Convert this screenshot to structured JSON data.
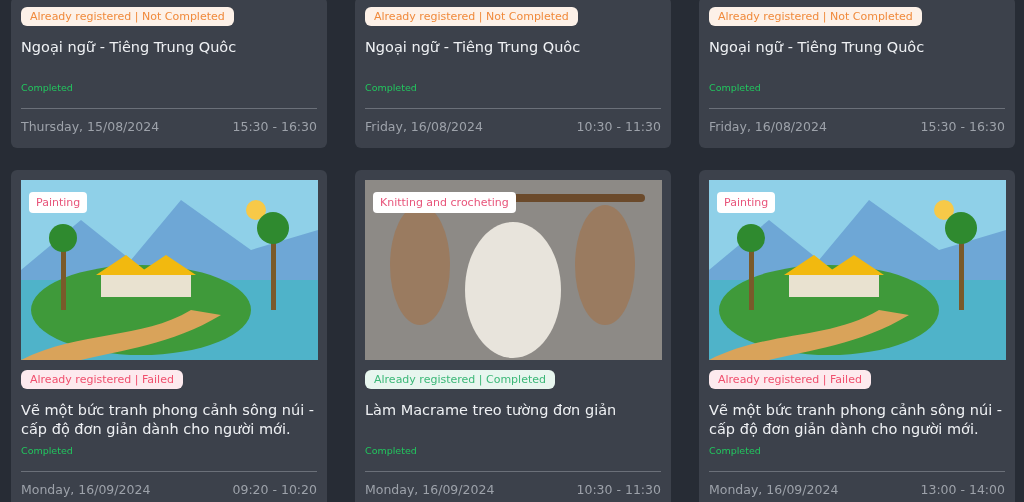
{
  "cards": [
    {
      "badge": {
        "text": "Already registered | Not Completed",
        "color": "#f08a3c"
      },
      "title": "Ngoại ngữ - Tiêng Trung Quôc",
      "result": "Completed",
      "date": "Thursday, 15/08/2024",
      "time": "15:30 - 16:30"
    },
    {
      "badge": {
        "text": "Already registered | Not Completed",
        "color": "#f08a3c"
      },
      "title": "Ngoại ngữ - Tiêng Trung Quôc",
      "result": "Completed",
      "date": "Friday, 16/08/2024",
      "time": "10:30 - 11:30"
    },
    {
      "badge": {
        "text": "Already registered | Not Completed",
        "color": "#f08a3c"
      },
      "title": "Ngoại ngữ - Tiêng Trung Quôc",
      "result": "Completed",
      "date": "Friday, 16/08/2024",
      "time": "15:30 - 16:30"
    },
    {
      "picture": {
        "kind": "painting",
        "tag": "Painting"
      },
      "badge": {
        "text": "Already registered | Failed",
        "color": "#f0506e"
      },
      "title": "Vẽ một bức tranh phong cảnh sông núi - cấp độ đơn giản dành cho người mới.",
      "result": "Completed",
      "date": "Monday, 16/09/2024",
      "time": "09:20 - 10:20"
    },
    {
      "picture": {
        "kind": "macrame",
        "tag": "Knitting and crocheting"
      },
      "badge": {
        "text": "Already registered | Completed",
        "color": "#3cb878"
      },
      "title": "Làm Macrame treo tường đơn giản",
      "result": "Completed",
      "date": "Monday, 16/09/2024",
      "time": "10:30 - 11:30"
    },
    {
      "picture": {
        "kind": "painting",
        "tag": "Painting"
      },
      "badge": {
        "text": "Already registered | Failed",
        "color": "#f0506e"
      },
      "title": "Vẽ một bức tranh phong cảnh sông núi - cấp độ đơn giản dành cho người mới.",
      "result": "Completed",
      "date": "Monday, 16/09/2024",
      "time": "13:00 - 14:00"
    }
  ]
}
